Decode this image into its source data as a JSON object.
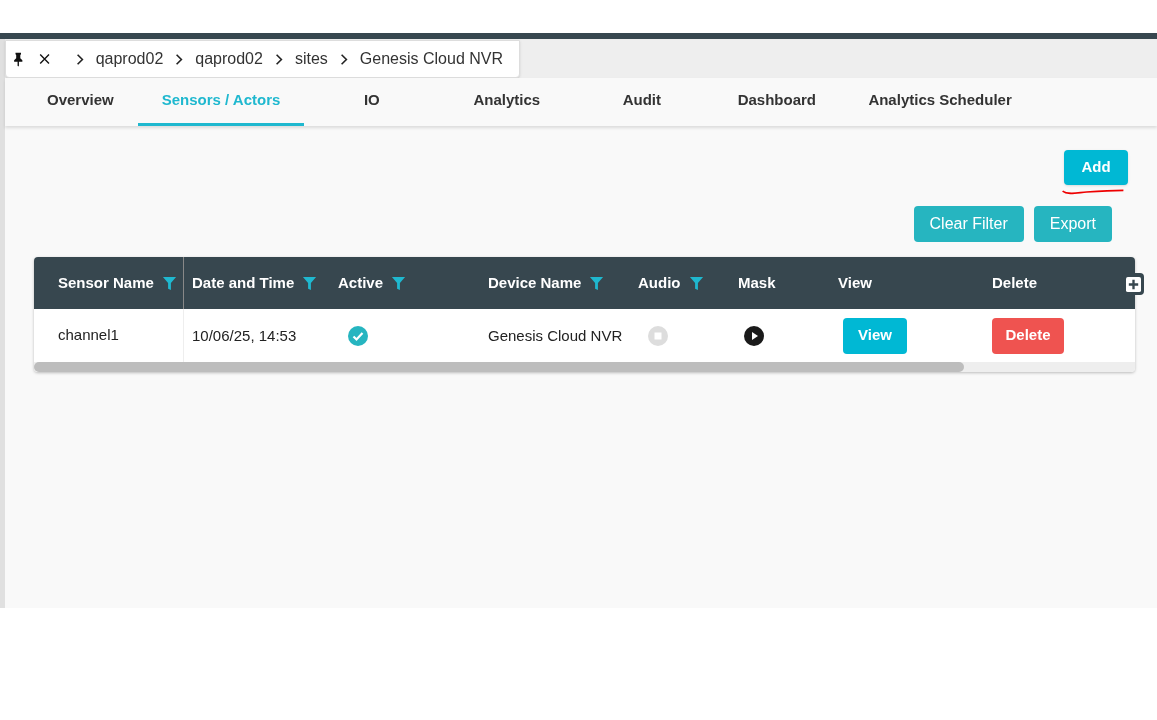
{
  "breadcrumb": [
    "qaprod02",
    "qaprod02",
    "sites",
    "Genesis Cloud NVR"
  ],
  "tabs": [
    {
      "label": "Overview",
      "selected": false
    },
    {
      "label": "Sensors / Actors",
      "selected": true
    },
    {
      "label": "IO",
      "selected": false
    },
    {
      "label": "Analytics",
      "selected": false
    },
    {
      "label": "Audit",
      "selected": false
    },
    {
      "label": "Dashboard",
      "selected": false
    },
    {
      "label": "Analytics Scheduler",
      "selected": false
    }
  ],
  "buttons": {
    "add": "Add",
    "clear_filter": "Clear Filter",
    "export": "Export"
  },
  "table": {
    "columns": [
      {
        "label": "Sensor Name",
        "filter": true
      },
      {
        "label": "Date and Time",
        "filter": true
      },
      {
        "label": "Active",
        "filter": true
      },
      {
        "label": "Device Name",
        "filter": true
      },
      {
        "label": "Audio",
        "filter": true
      },
      {
        "label": "Mask",
        "filter": false
      },
      {
        "label": "View",
        "filter": false
      },
      {
        "label": "Delete",
        "filter": false
      }
    ],
    "rows": [
      {
        "sensor_name": "channel1",
        "date_time": "10/06/25, 14:53",
        "active": true,
        "device_name": "Genesis Cloud NVR",
        "audio": false,
        "view": "View",
        "delete": "Delete"
      }
    ]
  }
}
